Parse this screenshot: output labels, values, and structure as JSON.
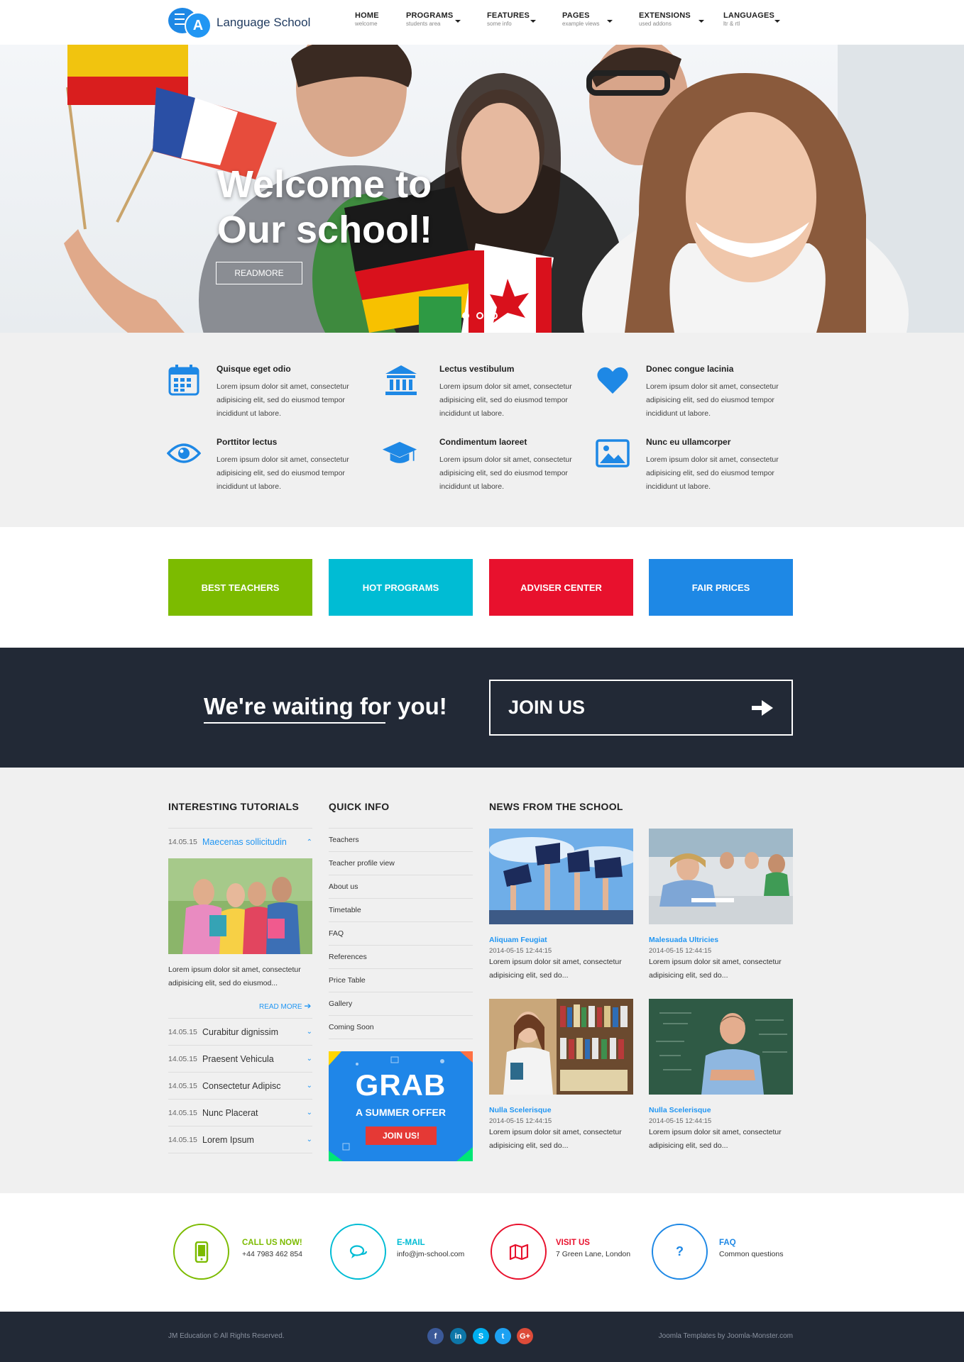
{
  "brand": {
    "name": "Language School",
    "logo_letter": "A"
  },
  "nav": [
    {
      "label": "HOME",
      "sub": "welcome"
    },
    {
      "label": "PROGRAMS",
      "sub": "students area"
    },
    {
      "label": "FEATURES",
      "sub": "some info"
    },
    {
      "label": "PAGES",
      "sub": "example views"
    },
    {
      "label": "EXTENSIONS",
      "sub": "used addons"
    },
    {
      "label": "LANGUAGES",
      "sub": "ltr & rtl"
    }
  ],
  "hero": {
    "title_line1": "Welcome to",
    "title_line2": "Our school!",
    "button": "READMORE",
    "slides": 3,
    "active_slide": 1
  },
  "features": [
    {
      "icon": "calendar-icon",
      "title": "Quisque eget odio",
      "text": "Lorem ipsum dolor sit amet, consectetur adipisicing elit, sed do eiusmod tempor incididunt ut labore."
    },
    {
      "icon": "bank-icon",
      "title": "Lectus vestibulum",
      "text": "Lorem ipsum dolor sit amet, consectetur adipisicing elit, sed do eiusmod tempor incididunt ut labore."
    },
    {
      "icon": "heart-icon",
      "title": "Donec congue lacinia",
      "text": "Lorem ipsum dolor sit amet, consectetur adipisicing elit, sed do eiusmod tempor incididunt ut labore."
    },
    {
      "icon": "eye-icon",
      "title": "Porttitor lectus",
      "text": "Lorem ipsum dolor sit amet, consectetur adipisicing elit, sed do eiusmod tempor incididunt ut labore."
    },
    {
      "icon": "graduation-cap-icon",
      "title": "Condimentum laoreet",
      "text": "Lorem ipsum dolor sit amet, consectetur adipisicing elit, sed do eiusmod tempor incididunt ut labore."
    },
    {
      "icon": "image-icon",
      "title": "Nunc eu ullamcorper",
      "text": "Lorem ipsum dolor sit amet, consectetur adipisicing elit, sed do eiusmod tempor incididunt ut labore."
    }
  ],
  "boxes": [
    {
      "label": "BEST TEACHERS",
      "color": "#7cbb00"
    },
    {
      "label": "HOT PROGRAMS",
      "color": "#00bcd4"
    },
    {
      "label": "ADVISER CENTER",
      "color": "#e8112d"
    },
    {
      "label": "FAIR PRICES",
      "color": "#2196f3"
    }
  ],
  "cta": {
    "text": "We're waiting for you!",
    "button": "JOIN US"
  },
  "tutorials": {
    "title": "INTERESTING TUTORIALS",
    "open": {
      "date": "14.05.15",
      "name": "Maecenas sollicitudin",
      "text": "Lorem ipsum dolor sit amet, consectetur adipisicing elit, sed do eiusmod...",
      "more": "READ MORE"
    },
    "items": [
      {
        "date": "14.05.15",
        "name": "Curabitur dignissim"
      },
      {
        "date": "14.05.15",
        "name": "Praesent Vehicula"
      },
      {
        "date": "14.05.15",
        "name": "Consectetur Adipisc"
      },
      {
        "date": "14.05.15",
        "name": "Nunc Placerat"
      },
      {
        "date": "14.05.15",
        "name": "Lorem Ipsum"
      }
    ]
  },
  "quick_info": {
    "title": "QUICK INFO",
    "links": [
      "Teachers",
      "Teacher profile view",
      "About us",
      "Timetable",
      "FAQ",
      "References",
      "Price Table",
      "Gallery",
      "Coming Soon"
    ],
    "banner": {
      "big": "GRAB",
      "sub": "A SUMMER OFFER",
      "button": "JOIN US!"
    }
  },
  "news": {
    "title": "NEWS FROM THE SCHOOL",
    "items": [
      {
        "title": "Aliquam Feugiat",
        "date": "2014-05-15 12:44:15",
        "text": "Lorem ipsum dolor sit amet, consectetur adipisicing elit, sed do..."
      },
      {
        "title": "Malesuada Ultricies",
        "date": "2014-05-15 12:44:15",
        "text": "Lorem ipsum dolor sit amet, consectetur adipisicing elit, sed do..."
      },
      {
        "title": "Nulla Scelerisque",
        "date": "2014-05-15 12:44:15",
        "text": "Lorem ipsum dolor sit amet, consectetur adipisicing elit, sed do..."
      },
      {
        "title": "Nulla Scelerisque",
        "date": "2014-05-15 12:44:15",
        "text": "Lorem ipsum dolor sit amet, consectetur adipisicing elit, sed do..."
      }
    ]
  },
  "contacts": [
    {
      "icon": "phone-icon",
      "label": "CALL US NOW!",
      "value": "+44 7983 462 854",
      "color": "#7cbb00"
    },
    {
      "icon": "chat-icon",
      "label": "E-MAIL",
      "value": "info@jm-school.com",
      "color": "#00bcd4"
    },
    {
      "icon": "map-icon",
      "label": "VISIT US",
      "value": "7 Green Lane, London",
      "color": "#e8112d"
    },
    {
      "icon": "question-icon",
      "label": "FAQ",
      "value": "Common questions",
      "color": "#2196f3"
    }
  ],
  "footer": {
    "copyright": "JM Education © All Rights Reserved.",
    "credit": "Joomla Templates by Joomla-Monster.com",
    "social": [
      {
        "icon": "facebook-icon",
        "glyph": "f",
        "color": "#3b5998"
      },
      {
        "icon": "linkedin-icon",
        "glyph": "in",
        "color": "#0e76a8"
      },
      {
        "icon": "skype-icon",
        "glyph": "S",
        "color": "#00aff0"
      },
      {
        "icon": "twitter-icon",
        "glyph": "t",
        "color": "#1da1f2"
      },
      {
        "icon": "googleplus-icon",
        "glyph": "G+",
        "color": "#dd4b39"
      }
    ]
  }
}
